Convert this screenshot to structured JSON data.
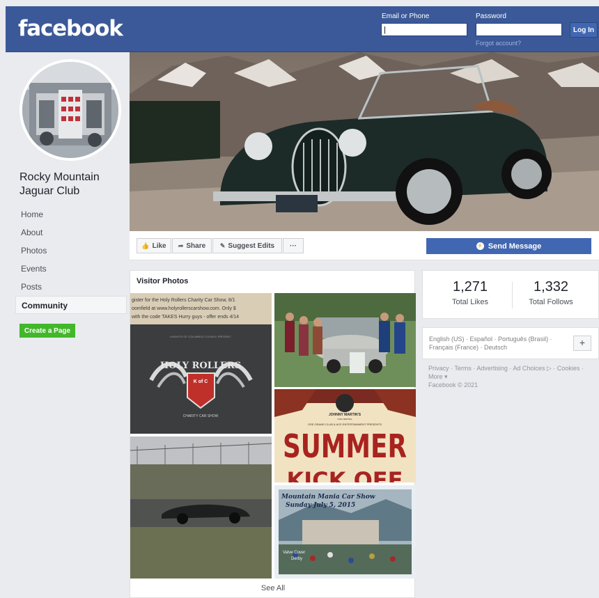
{
  "header": {
    "logo": "facebook",
    "email_label": "Email or Phone",
    "password_label": "Password",
    "login_button": "Log In",
    "forgot_link": "Forgot account?"
  },
  "page": {
    "name": "Rocky Mountain Jaguar Club"
  },
  "nav": {
    "items": [
      "Home",
      "About",
      "Photos",
      "Events",
      "Posts",
      "Community"
    ],
    "active": "Community"
  },
  "create_page_button": "Create a Page",
  "actions": {
    "like": "Like",
    "share": "Share",
    "suggest": "Suggest Edits",
    "more": "···",
    "send_message": "Send Message"
  },
  "visitor_photos": {
    "title": "Visitor Photos",
    "see_all": "See All",
    "holy_rollers": {
      "ad_line1": "gister for the Holy Rollers Charity Car Show, 8/1",
      "ad_line2": "oomfield at www.holyrollerscarshow.com. Only $",
      "ad_line3": "with the code TAKES  Hurry guys - offer ends 4/14",
      "presents": "KNIGHTS OF COLUMBUS COUNCIL PRESENT",
      "badge_top": "HOLY ROLLERS",
      "badge_mid": "K of C",
      "badge_bottom": "CHARITY CAR SHOW"
    },
    "summer": {
      "brand_line1": "JOHNNY MARTIN'S",
      "brand_line2": "CAR CENTRAL",
      "presents": "OSE GRAND CLUB & ACE ENTERTAINMENT PRESENTS",
      "title": "SUMMER",
      "subtitle": "KICK OFF"
    },
    "mountain_mania": {
      "line1": "Mountain Mania Car Show",
      "line2": "Sunday  July 5, 2015",
      "caption1": "Valve Cover",
      "caption2": "Derby"
    }
  },
  "stats": {
    "likes_value": "1,271",
    "likes_label": "Total Likes",
    "follows_value": "1,332",
    "follows_label": "Total Follows"
  },
  "languages": {
    "text": "English (US) · Español · Português (Brasil) · Français (France) · Deutsch",
    "add": "+"
  },
  "footer": {
    "links": "Privacy · Terms · Advertising · Ad Choices ▷ · Cookies · More ▾",
    "copyright": "Facebook © 2021"
  },
  "colors": {
    "brand": "#3b5998",
    "button_blue": "#4267b2",
    "green": "#42b72a",
    "background": "#e9ebee"
  },
  "icons": {
    "like": "thumbs-up-icon",
    "share": "share-arrow-icon",
    "suggest": "pencil-icon",
    "messenger": "messenger-icon"
  }
}
